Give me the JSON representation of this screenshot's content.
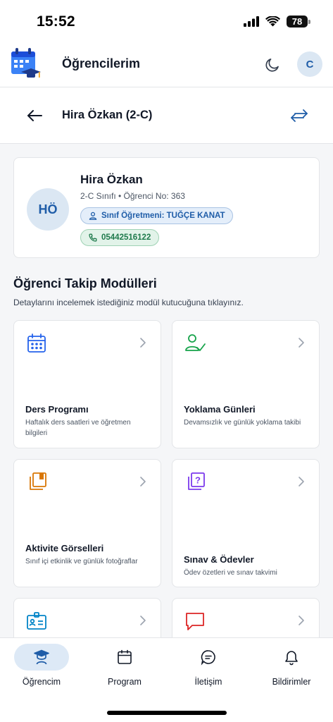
{
  "status_bar": {
    "time": "15:52",
    "battery": "78"
  },
  "header": {
    "title": "Öğrencilerim",
    "avatar_letter": "C"
  },
  "subheader": {
    "title": "Hira Özkan (2-C)"
  },
  "student": {
    "initials": "HÖ",
    "name": "Hira Özkan",
    "meta": "2-C Sınıfı • Öğrenci No: 363",
    "teacher": "Sınıf Öğretmeni: TUĞÇE KANAT",
    "phone": "05442516122"
  },
  "section": {
    "title": "Öğrenci Takip Modülleri",
    "subtitle": "Detaylarını incelemek istediğiniz modül kutucuğuna tıklayınız."
  },
  "modules": [
    {
      "title": "Ders Programı",
      "desc": "Haftalık ders saatleri ve öğretmen bilgileri",
      "icon": "calendar-icon",
      "color": "#2563eb"
    },
    {
      "title": "Yoklama Günleri",
      "desc": "Devamsızlık ve günlük yoklama takibi",
      "icon": "user-check-icon",
      "color": "#16a34a"
    },
    {
      "title": "Aktivite Görselleri",
      "desc": "Sınıf içi etkinlik ve günlük fotoğraflar",
      "icon": "photo-album-icon",
      "color": "#d97706"
    },
    {
      "title": "Sınav & Ödevler",
      "desc": "Ödev özetleri ve sınav takvimi",
      "icon": "question-book-icon",
      "color": "#7c3aed"
    },
    {
      "title": "",
      "desc": "",
      "icon": "id-card-icon",
      "color": "#0284c7"
    },
    {
      "title": "",
      "desc": "",
      "icon": "message-icon",
      "color": "#dc2626"
    }
  ],
  "nav": [
    {
      "label": "Öğrencim",
      "icon": "student-icon",
      "active": true
    },
    {
      "label": "Program",
      "icon": "calendar-icon",
      "active": false
    },
    {
      "label": "İletişim",
      "icon": "chat-icon",
      "active": false
    },
    {
      "label": "Bildirimler",
      "icon": "bell-icon",
      "active": false
    }
  ],
  "colors": {
    "accent": "#1f5da8",
    "accent_bg": "#dbe7f3",
    "phone_green": "#1f7a4c",
    "background": "#f5f6f8"
  }
}
